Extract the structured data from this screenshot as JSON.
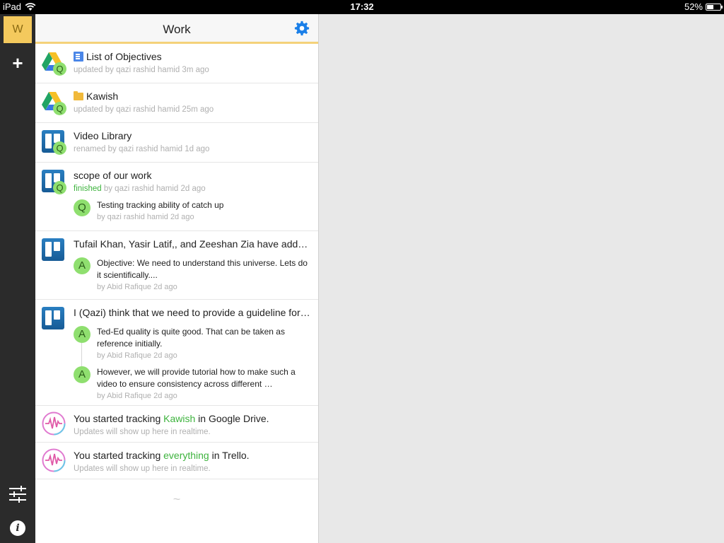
{
  "status_bar": {
    "device": "iPad",
    "time": "17:32",
    "battery": "52%",
    "battery_level": 0.52
  },
  "rail": {
    "workspace_initial": "W",
    "add_label": "+",
    "info_label": "i"
  },
  "panel": {
    "title": "Work",
    "footer": "~"
  },
  "feed": [
    {
      "title": "List of Objectives",
      "meta": "updated by qazi rashid hamid 3m ago",
      "badge": "Q"
    },
    {
      "title": "Kawish",
      "meta": "updated by qazi rashid hamid 25m ago",
      "badge": "Q"
    },
    {
      "title": "Video Library",
      "meta": "renamed by qazi rashid hamid 1d ago",
      "badge": "Q"
    },
    {
      "title": "scope of our work",
      "meta_status": "finished",
      "meta_rest": " by qazi rashid hamid 2d ago",
      "badge": "Q",
      "comments": [
        {
          "avatar": "Q",
          "text": "Testing tracking ability of catch up",
          "by": "by qazi rashid hamid 2d ago"
        }
      ]
    },
    {
      "title": "Tufail Khan, Yasir Latif,, and Zeeshan Zia have add…",
      "comments": [
        {
          "avatar": "A",
          "text": "Objective: We need to understand this universe. Lets do it scientifically....",
          "by": "by Abid Rafique 2d ago"
        }
      ]
    },
    {
      "title": "I (Qazi) think that we need to provide a guideline for…",
      "comments": [
        {
          "avatar": "A",
          "text": "Ted-Ed quality is quite good. That can be taken as reference initially.",
          "by": "by Abid Rafique 2d ago"
        },
        {
          "avatar": "A",
          "text": "However, we will provide tutorial how to make such a video to ensure consistency across different …",
          "by": "by Abid Rafique 2d ago"
        }
      ]
    },
    {
      "title_pre": "You started tracking ",
      "title_link": "Kawish",
      "title_post": " in Google Drive.",
      "meta": "Updates will show up here in realtime."
    },
    {
      "title_pre": "You started tracking ",
      "title_link": "everything",
      "title_post": " in Trello.",
      "meta": "Updates will show up here in realtime."
    }
  ],
  "colors": {
    "accent_yellow": "#f4c95d",
    "link_green": "#3db33d",
    "gear_blue": "#1a7fe8",
    "badge_green": "#8fdf6f"
  }
}
